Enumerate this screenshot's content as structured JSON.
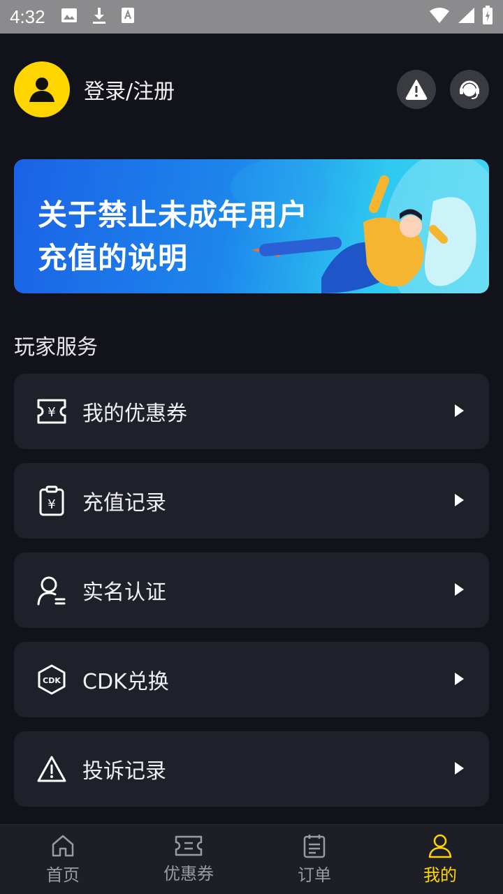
{
  "status_bar": {
    "time": "4:32"
  },
  "header": {
    "login_label": "登录/注册"
  },
  "banner": {
    "line1": "关于禁止未成年用户",
    "line2": "充值的说明"
  },
  "section": {
    "title": "玩家服务"
  },
  "menu": [
    {
      "label": "我的优惠券",
      "icon": "coupon-icon"
    },
    {
      "label": "充值记录",
      "icon": "recharge-record-icon"
    },
    {
      "label": "实名认证",
      "icon": "user-verify-icon"
    },
    {
      "label": "CDK兑换",
      "icon": "cdk-icon"
    },
    {
      "label": "投诉记录",
      "icon": "warning-icon"
    }
  ],
  "bottom_nav": [
    {
      "label": "首页",
      "icon": "home-icon",
      "active": false
    },
    {
      "label": "优惠券",
      "icon": "coupon-icon",
      "active": false
    },
    {
      "label": "订单",
      "icon": "order-icon",
      "active": false
    },
    {
      "label": "我的",
      "icon": "profile-icon",
      "active": true
    }
  ],
  "colors": {
    "accent": "#ffd500",
    "background": "#12131a",
    "card": "#1f212a",
    "inactive": "#9a9ba2"
  }
}
